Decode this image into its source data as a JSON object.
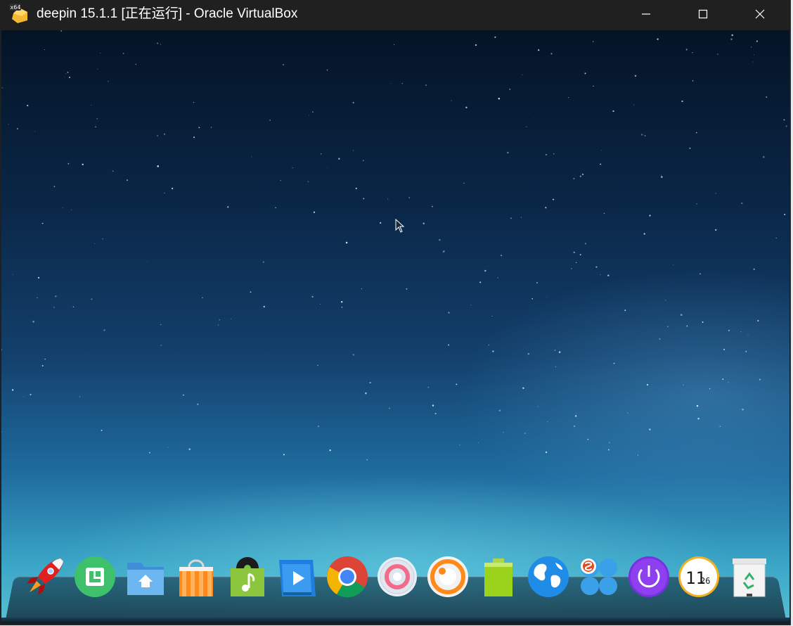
{
  "window": {
    "title": "deepin 15.1.1 [正在运行] - Oracle VirtualBox",
    "app_icon_badge": "x64",
    "buttons": [
      "minimize",
      "maximize",
      "close"
    ]
  },
  "desktop": {
    "wallpaper": "starry-night-sky",
    "colors": {
      "sky_top": "#041426",
      "sky_mid": "#13406c",
      "horizon": "#59c0d3"
    }
  },
  "dock": {
    "items": [
      {
        "name": "launcher",
        "icon": "rocket-icon"
      },
      {
        "name": "deepin-store",
        "icon": "green-store-icon"
      },
      {
        "name": "file-manager",
        "icon": "folder-home-icon"
      },
      {
        "name": "app-store",
        "icon": "shopping-bag-icon"
      },
      {
        "name": "music",
        "icon": "music-icon"
      },
      {
        "name": "video-player",
        "icon": "video-icon"
      },
      {
        "name": "chrome",
        "icon": "chrome-icon"
      },
      {
        "name": "settings",
        "icon": "settings-gear-icon"
      },
      {
        "name": "screen-recorder",
        "icon": "recorder-icon"
      },
      {
        "name": "battery",
        "icon": "battery-icon"
      },
      {
        "name": "network",
        "icon": "globe-icon"
      },
      {
        "name": "input-method",
        "icon": "sogou-input-icon"
      },
      {
        "name": "shutdown",
        "icon": "power-icon"
      },
      {
        "name": "clock",
        "icon": "clock-icon"
      },
      {
        "name": "trash",
        "icon": "trash-icon"
      }
    ],
    "clock": {
      "hour": "11",
      "minute": "26"
    }
  }
}
